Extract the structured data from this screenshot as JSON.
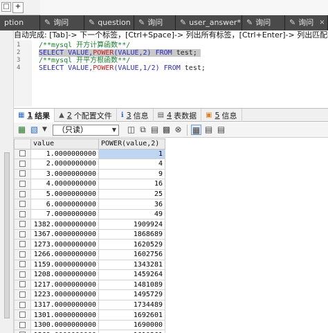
{
  "topbar": {
    "icon_left": "□",
    "icon_right": "+"
  },
  "query_tabs": [
    {
      "icon": "",
      "label": "ption",
      "close": ""
    },
    {
      "icon": "✎",
      "label": "询问",
      "close": ""
    },
    {
      "icon": "✎",
      "label": "question",
      "close": ""
    },
    {
      "icon": "✎",
      "label": "询问",
      "close": ""
    },
    {
      "icon": "✎",
      "label": "user_answer*",
      "close": ""
    },
    {
      "icon": "✎",
      "label": "询问",
      "close": ""
    },
    {
      "icon": "✎",
      "label": "询问",
      "close": "×"
    }
  ],
  "hint": "自动完成: [Tab]-> 下一个标签，[Ctrl+Space]-> 列出所有标签，[Ctrl+Enter]-> 列出匹配标签",
  "editor": {
    "line_numbers": [
      "1",
      "2",
      "3",
      "4"
    ],
    "line1_comment": "/**mysql 开方计算函数**/",
    "line2": {
      "select": "SELECT",
      "value": "VALUE,",
      "power": "POWER",
      "args": "(VALUE,2)",
      "from": "FROM",
      "table": "test;"
    },
    "line3_comment": "/**mysql 开平方根函数**/",
    "line4": {
      "select": "SELECT",
      "value": "VALUE,",
      "power": "POWER",
      "args": "(VALUE,1/2)",
      "from": "FROM",
      "table": "test;"
    }
  },
  "result_tabs": [
    {
      "icon": "▦",
      "num": "1",
      "label": "结果"
    },
    {
      "icon": "▲",
      "num": "2",
      "label": "个配置文件"
    },
    {
      "icon": "ℹ",
      "num": "3",
      "label": "信息"
    },
    {
      "icon": "▤",
      "num": "4",
      "label": "表数据"
    },
    {
      "icon": "▣",
      "num": "5",
      "label": "信息"
    }
  ],
  "toolbar": {
    "mode_select": "（只读）"
  },
  "grid": {
    "columns": [
      "value",
      "POWER(value,2)"
    ],
    "rows": [
      [
        "1.0000000000",
        "1"
      ],
      [
        "2.0000000000",
        "4"
      ],
      [
        "3.0000000000",
        "9"
      ],
      [
        "4.0000000000",
        "16"
      ],
      [
        "5.0000000000",
        "25"
      ],
      [
        "6.0000000000",
        "36"
      ],
      [
        "7.0000000000",
        "49"
      ],
      [
        "1382.0000000000",
        "1909924"
      ],
      [
        "1367.0000000000",
        "1868689"
      ],
      [
        "1273.0000000000",
        "1620529"
      ],
      [
        "1266.0000000000",
        "1602756"
      ],
      [
        "1159.0000000000",
        "1343281"
      ],
      [
        "1208.0000000000",
        "1459264"
      ],
      [
        "1217.0000000000",
        "1481089"
      ],
      [
        "1223.0000000000",
        "1495729"
      ],
      [
        "1317.0000000000",
        "1734489"
      ],
      [
        "1301.0000000000",
        "1692601"
      ],
      [
        "1300.0000000000",
        "1690000"
      ],
      [
        "1269.0000000000",
        "1610361"
      ]
    ]
  }
}
